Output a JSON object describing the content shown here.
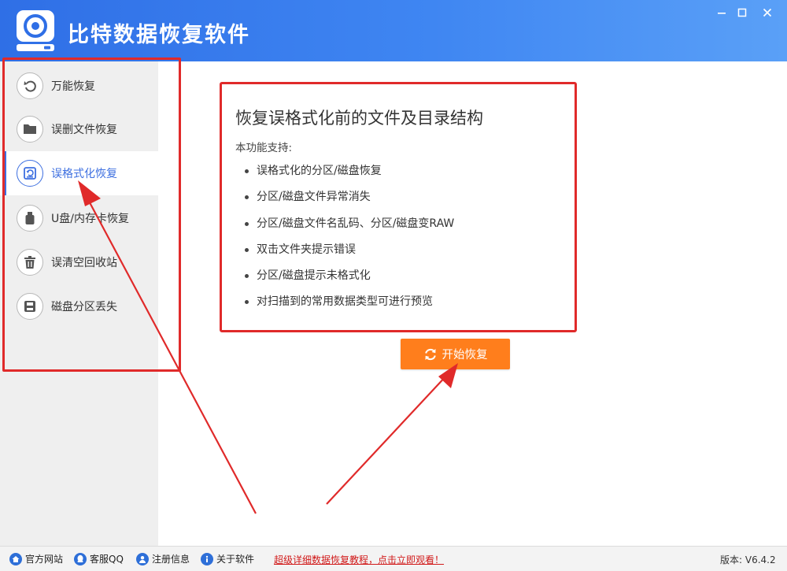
{
  "window": {
    "title": "比特数据恢复软件",
    "controls": [
      "minimize-icon",
      "maximize-icon",
      "close-icon"
    ]
  },
  "sidebar": {
    "items": [
      {
        "label": "万能恢复",
        "icon": "undo-icon",
        "active": false
      },
      {
        "label": "误删文件恢复",
        "icon": "folder-icon",
        "active": false
      },
      {
        "label": "误格式化恢复",
        "icon": "disk-restore-icon",
        "active": true
      },
      {
        "label": "U盘/内存卡恢复",
        "icon": "usb-icon",
        "active": false
      },
      {
        "label": "误清空回收站",
        "icon": "trash-icon",
        "active": false
      },
      {
        "label": "磁盘分区丢失",
        "icon": "drive-icon",
        "active": false
      }
    ]
  },
  "main": {
    "title": "恢复误格式化前的文件及目录结构",
    "subtitle": "本功能支持:",
    "features": [
      "误格式化的分区/磁盘恢复",
      "分区/磁盘文件异常消失",
      "分区/磁盘文件名乱码、分区/磁盘变RAW",
      "双击文件夹提示错误",
      "分区/磁盘提示未格式化",
      "对扫描到的常用数据类型可进行预览"
    ],
    "start_button": "开始恢复"
  },
  "statusbar": {
    "links": [
      {
        "label": "官方网站",
        "icon": "home-icon"
      },
      {
        "label": "客服QQ",
        "icon": "qq-icon"
      },
      {
        "label": "注册信息",
        "icon": "user-icon"
      },
      {
        "label": "关于软件",
        "icon": "info-icon"
      }
    ],
    "promo": "超级详细数据恢复教程，点击立即观看！",
    "version": "版本: V6.4.2"
  },
  "colors": {
    "titlebar": "#3f86f2",
    "accent": "#3d6fe0",
    "start_button": "#ff7e1c",
    "annotation": "#e02a2a",
    "promo_text": "#d11a1a"
  }
}
